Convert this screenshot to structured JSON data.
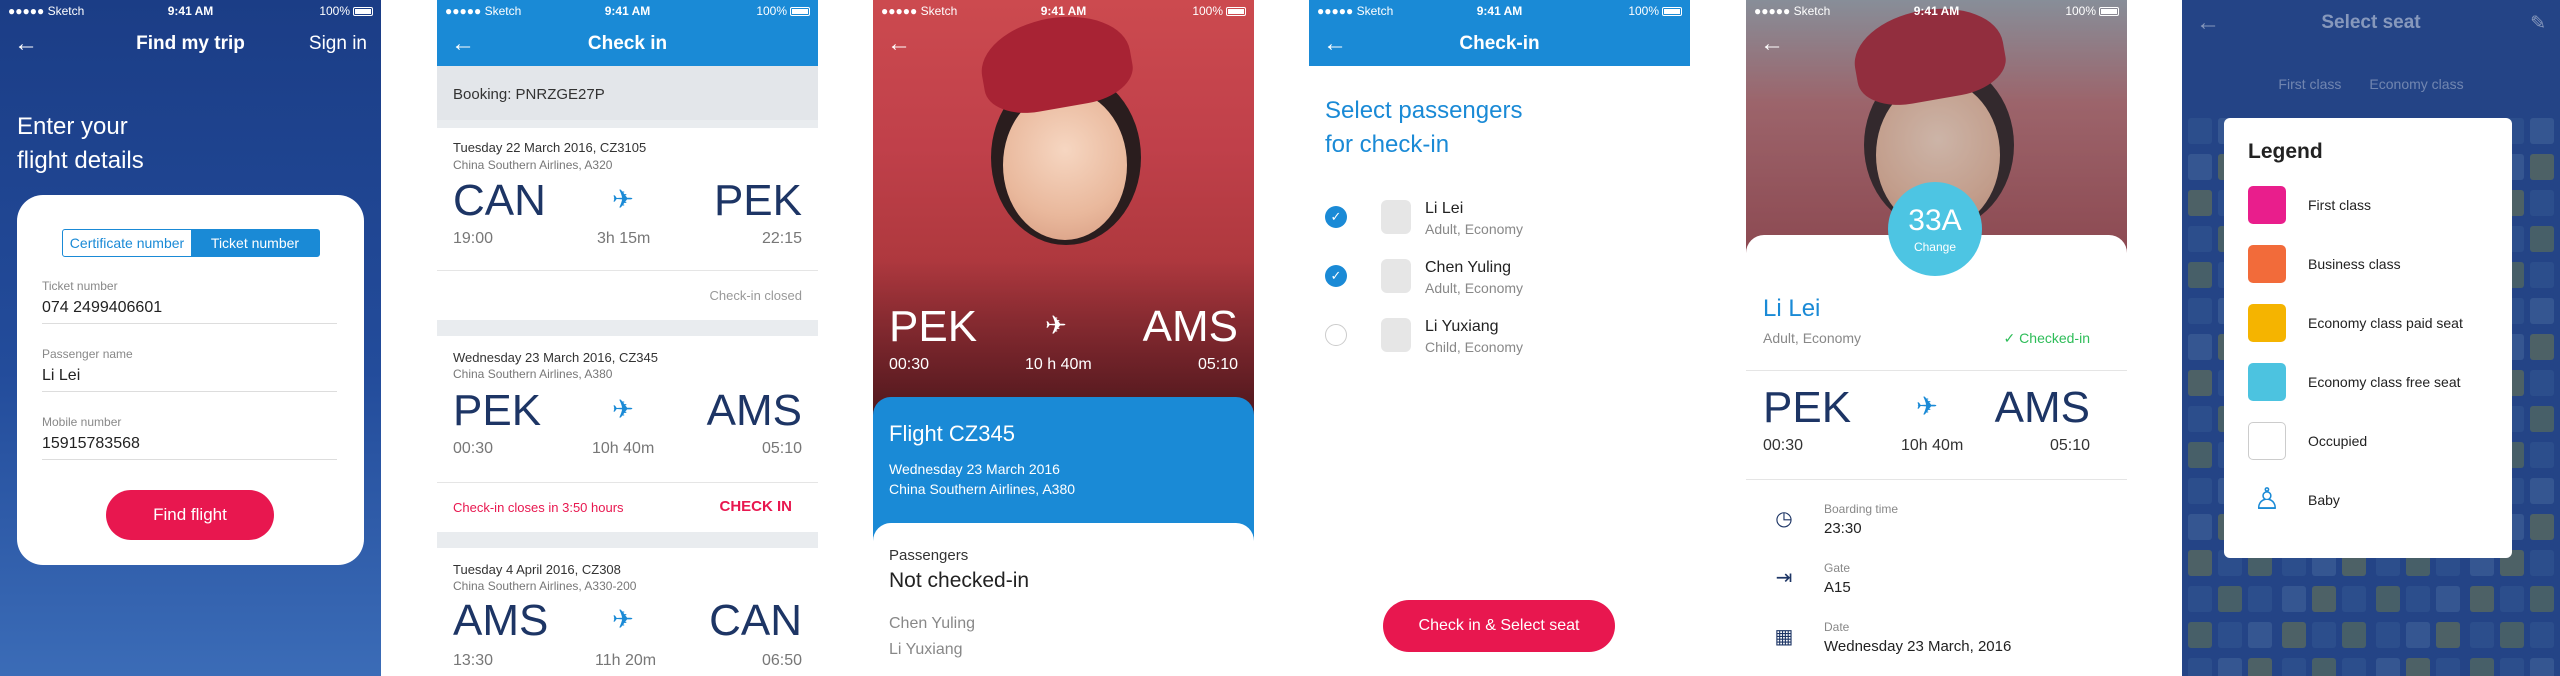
{
  "status": {
    "carrier": "●●●●● Sketch",
    "time": "9:41 AM",
    "battery": "100%"
  },
  "s1": {
    "back_icon": "←",
    "title": "Find my trip",
    "sign_in": "Sign in",
    "headline1": "Enter your",
    "headline2": "flight details",
    "seg_certificate": "Certificate number",
    "seg_ticket": "Ticket number",
    "ticket_label": "Ticket number",
    "ticket_value": "074 2499406601",
    "name_label": "Passenger name",
    "name_value": "Li Lei",
    "mobile_label": "Mobile number",
    "mobile_value": "15915783568",
    "button": "Find flight"
  },
  "s2": {
    "title": "Check in",
    "booking": "Booking: PNRZGE27P",
    "trips": [
      {
        "date": "Tuesday 22 March 2016, CZ3105",
        "airline": "China Southern Airlines, A320",
        "from": "CAN",
        "to": "PEK",
        "dep": "19:00",
        "dur": "3h 15m",
        "arr": "22:15",
        "status": "Check-in closed"
      },
      {
        "date": "Wednesday 23 March 2016, CZ345",
        "airline": "China Southern Airlines, A380",
        "from": "PEK",
        "to": "AMS",
        "dep": "00:30",
        "dur": "10h 40m",
        "arr": "05:10",
        "status": "Check-in closes in 3:50 hours",
        "action": "CHECK IN"
      },
      {
        "date": "Tuesday 4 April 2016, CZ308",
        "airline": "China Southern Airlines, A330-200",
        "from": "AMS",
        "to": "CAN",
        "dep": "13:30",
        "dur": "11h 20m",
        "arr": "06:50"
      }
    ]
  },
  "s3": {
    "from": "PEK",
    "to": "AMS",
    "dep": "00:30",
    "dur": "10 h 40m",
    "arr": "05:10",
    "flight": "Flight CZ345",
    "date": "Wednesday 23 March 2016",
    "airline": "China Southern Airlines, A380",
    "pax_label": "Passengers",
    "pax_status": "Not checked-in",
    "pax1": "Chen Yuling",
    "pax2": "Li Yuxiang"
  },
  "s4": {
    "title": "Check-in",
    "heading1": "Select passengers",
    "heading2": "for check-in",
    "passengers": [
      {
        "name": "Li Lei",
        "type": "Adult, Economy",
        "checked": true
      },
      {
        "name": "Chen Yuling",
        "type": "Adult, Economy",
        "checked": true
      },
      {
        "name": "Li Yuxiang",
        "type": "Child, Economy",
        "checked": false
      }
    ],
    "button": "Check in & Select seat"
  },
  "s5": {
    "seat": "33A",
    "change": "Change",
    "name": "Li Lei",
    "type": "Adult, Economy",
    "status": "Checked-in",
    "from": "PEK",
    "to": "AMS",
    "dep": "00:30",
    "dur": "10h 40m",
    "arr": "05:10",
    "boarding_label": "Boarding time",
    "boarding_value": "23:30",
    "gate_label": "Gate",
    "gate_value": "A15",
    "date_label": "Date",
    "date_value": "Wednesday 23 March, 2016"
  },
  "s6": {
    "title": "Select seat",
    "tab_first": "First class",
    "tab_economy": "Economy class",
    "legend_title": "Legend",
    "legend": [
      {
        "label": "First class",
        "color": "#e91e8c"
      },
      {
        "label": "Business class",
        "color": "#f26b3a"
      },
      {
        "label": "Economy class paid seat",
        "color": "#f5b400"
      },
      {
        "label": "Economy class free seat",
        "color": "#4cc3e0"
      },
      {
        "label": "Occupied",
        "color": "#ffffff"
      },
      {
        "label": "Baby",
        "color": "#1a8ad6"
      }
    ]
  },
  "colors": {
    "blue": "#1a8ad6",
    "navy": "#1d3565",
    "pink": "#e8174f",
    "green": "#2ebd59"
  }
}
